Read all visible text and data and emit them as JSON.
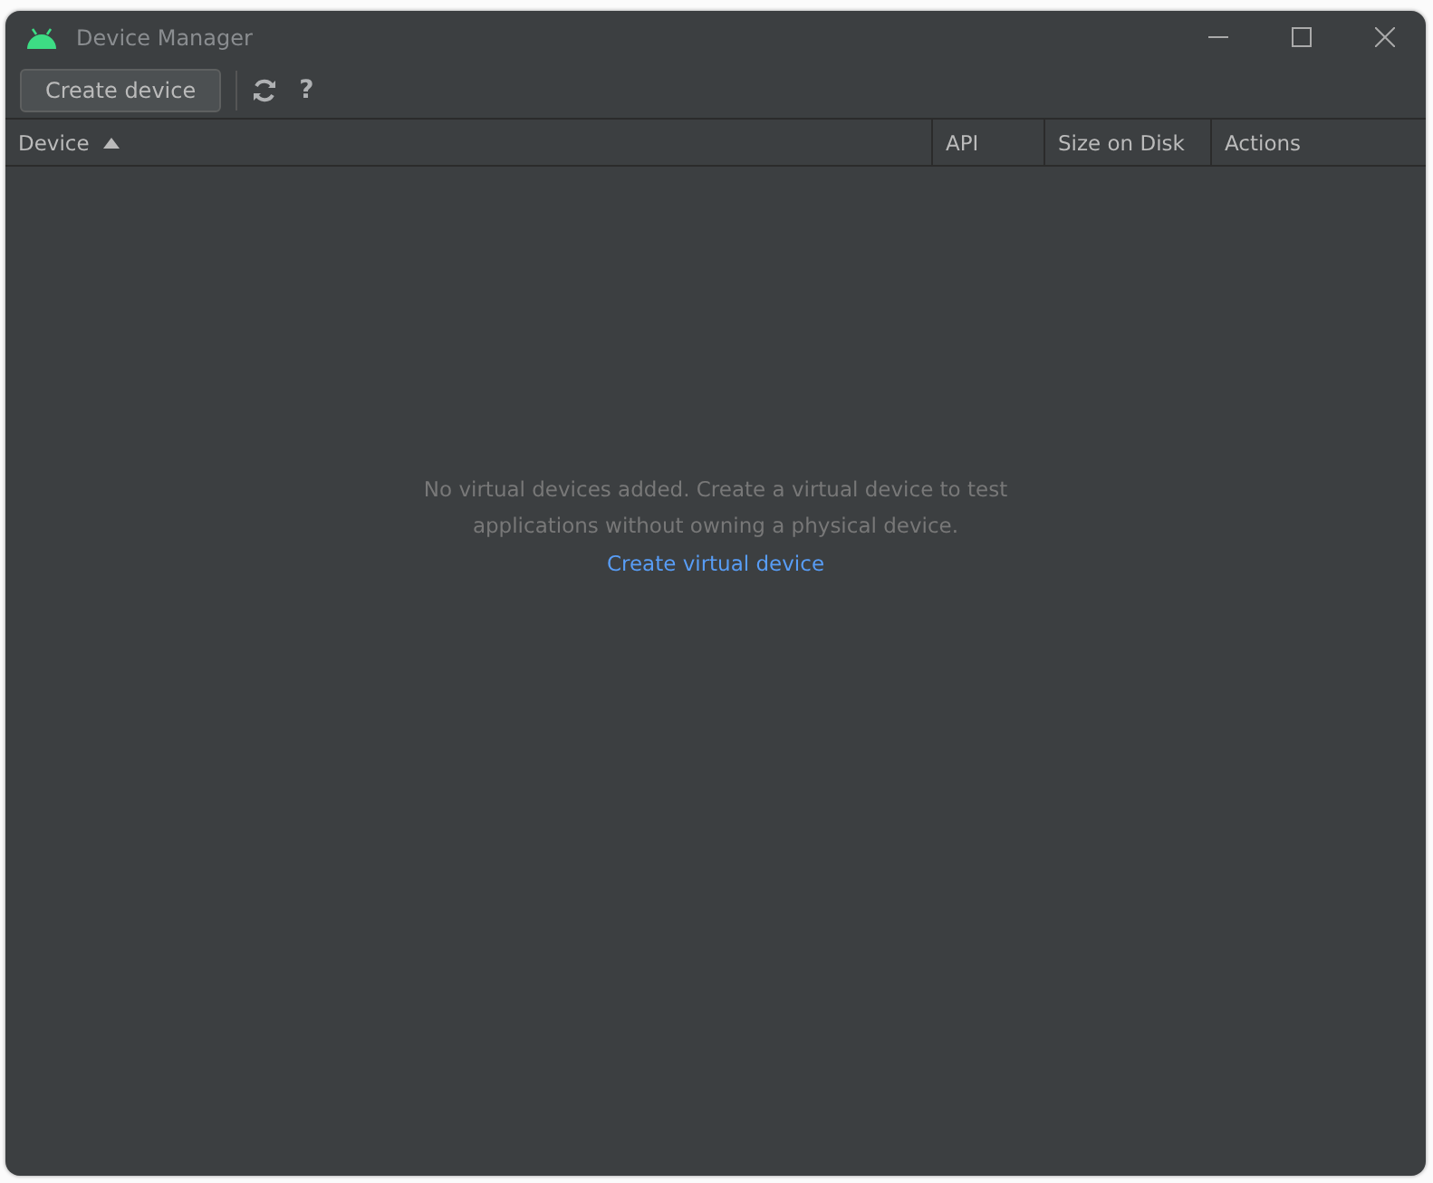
{
  "window": {
    "title": "Device Manager"
  },
  "toolbar": {
    "create_button": "Create device",
    "help": "?"
  },
  "table": {
    "columns": [
      {
        "label": "Device",
        "sorted": true
      },
      {
        "label": "API",
        "sorted": false
      },
      {
        "label": "Size on Disk",
        "sorted": false
      },
      {
        "label": "Actions",
        "sorted": false
      }
    ]
  },
  "empty_state": {
    "message_lines": [
      "No virtual devices added. Create a virtual device to test",
      "applications without owning a physical device."
    ],
    "link": "Create virtual device"
  }
}
